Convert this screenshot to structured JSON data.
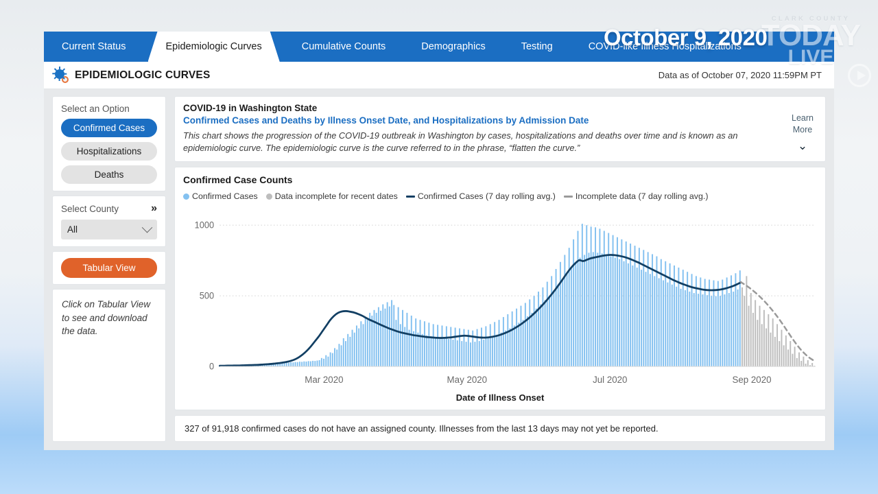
{
  "overlay": {
    "date_text": "October 9, 2020",
    "watermark": {
      "line1": "CLARK COUNTY",
      "line2": "TODAY",
      "line3": "LIVE",
      "play_icon": "play-circle-icon"
    }
  },
  "tabs": [
    {
      "label": "Current Status",
      "active": false
    },
    {
      "label": "Epidemiologic Curves",
      "active": true
    },
    {
      "label": "Cumulative Counts",
      "active": false
    },
    {
      "label": "Demographics",
      "active": false
    },
    {
      "label": "Testing",
      "active": false
    },
    {
      "label": "COVID-like Illness Hospitalizations",
      "active": false
    }
  ],
  "header": {
    "logo_icon": "virus-icon",
    "title": "EPIDEMIOLOGIC CURVES",
    "data_asof": "Data as of October 07, 2020 11:59PM PT"
  },
  "sidebar": {
    "option_label": "Select an Option",
    "options": [
      {
        "label": "Confirmed Cases",
        "selected": true
      },
      {
        "label": "Hospitalizations",
        "selected": false
      },
      {
        "label": "Deaths",
        "selected": false
      }
    ],
    "county_label": "Select County",
    "county_expand_icon": "chevron-double-right-icon",
    "county_value": "All",
    "county_dropdown_icon": "chevron-down-icon",
    "tabular_view_label": "Tabular View",
    "hint": "Click on Tabular View to see and download the data."
  },
  "intro": {
    "title": "COVID-19 in Washington State",
    "subtitle": "Confirmed Cases and Deaths by Illness Onset Date, and Hospitalizations by Admission Date",
    "description": "This chart shows the progression of the COVID-19 outbreak in Washington by cases, hospitalizations and deaths over time and is known as an epidemiologic curve. The epidemiologic curve is the curve referred to in the phrase, “flatten the curve.”",
    "learn_more_line1": "Learn",
    "learn_more_line2": "More",
    "learn_more_icon": "chevron-double-down-icon"
  },
  "footer": {
    "note": "327 of 91,918 confirmed cases do not have an assigned county. Illnesses from the last 13 days may not yet be reported."
  },
  "colors": {
    "brand_blue": "#1b6ec2",
    "bar_blue": "#84c1f0",
    "bar_gray": "#bdbdbd",
    "line_navy": "#123f63",
    "line_gray": "#9a9a9a",
    "accent_orange": "#e0622a"
  },
  "chart_data": {
    "type": "bar",
    "title": "Confirmed Case Counts",
    "xlabel": "Date of Illness Onset",
    "ylabel": "",
    "ylim": [
      0,
      1100
    ],
    "yticks": [
      0,
      500,
      1000
    ],
    "ytick_labels": [
      "0",
      "500",
      "1000"
    ],
    "xtick_labels": [
      "Mar 2020",
      "May 2020",
      "Jul 2020",
      "Sep 2020"
    ],
    "xtick_positions": [
      0.175,
      0.415,
      0.655,
      0.893
    ],
    "grid": true,
    "legend_position": "top",
    "legend": [
      {
        "label": "Confirmed Cases",
        "marker": "dot",
        "color": "#84c1f0"
      },
      {
        "label": "Data incomplete for recent dates",
        "marker": "dot",
        "color": "#bdbdbd"
      },
      {
        "label": "Confirmed Cases (7 day rolling avg.)",
        "marker": "line",
        "color": "#123f63"
      },
      {
        "label": "Incomplete data (7 day rolling avg.)",
        "marker": "line",
        "color": "#9a9a9a"
      }
    ],
    "series": [
      {
        "name": "Confirmed Cases",
        "type": "bar",
        "color": "#84c1f0",
        "values": [
          2,
          1,
          3,
          2,
          4,
          3,
          5,
          4,
          6,
          5,
          8,
          7,
          10,
          9,
          12,
          11,
          14,
          13,
          16,
          15,
          18,
          17,
          20,
          19,
          22,
          21,
          24,
          23,
          26,
          25,
          28,
          27,
          30,
          29,
          32,
          31,
          34,
          33,
          36,
          35,
          38,
          37,
          40,
          39,
          42,
          45,
          60,
          55,
          80,
          70,
          100,
          95,
          130,
          120,
          160,
          150,
          200,
          180,
          230,
          210,
          260,
          240,
          290,
          270,
          320,
          300,
          350,
          330,
          380,
          360,
          400,
          380,
          420,
          395,
          440,
          410,
          455,
          425,
          470,
          435,
          330,
          420,
          300,
          400,
          280,
          380,
          260,
          360,
          250,
          340,
          240,
          330,
          230,
          320,
          220,
          310,
          215,
          300,
          210,
          295,
          205,
          290,
          200,
          285,
          195,
          280,
          190,
          275,
          185,
          270,
          180,
          265,
          175,
          260,
          170,
          255,
          175,
          265,
          180,
          275,
          190,
          285,
          200,
          300,
          210,
          315,
          225,
          330,
          240,
          350,
          255,
          370,
          270,
          390,
          290,
          410,
          310,
          430,
          330,
          450,
          355,
          475,
          380,
          500,
          410,
          530,
          440,
          560,
          470,
          600,
          500,
          640,
          540,
          690,
          580,
          740,
          620,
          790,
          660,
          840,
          700,
          900,
          740,
          960,
          770,
          1010,
          790,
          1000,
          805,
          990,
          810,
          985,
          805,
          975,
          800,
          960,
          790,
          945,
          780,
          930,
          770,
          915,
          760,
          900,
          745,
          885,
          730,
          870,
          715,
          855,
          700,
          840,
          685,
          825,
          670,
          810,
          655,
          795,
          640,
          780,
          625,
          760,
          610,
          745,
          595,
          730,
          580,
          715,
          565,
          700,
          550,
          685,
          540,
          670,
          530,
          655,
          520,
          640,
          515,
          630,
          510,
          620,
          505,
          615,
          500,
          610,
          498,
          605,
          500,
          615,
          510,
          630,
          520,
          645,
          530,
          660,
          545,
          680
        ],
        "note": "Daily confirmed cases by illness onset, Feb-Sep 2020"
      },
      {
        "name": "Data incomplete for recent dates",
        "type": "bar",
        "color": "#bdbdbd",
        "values": [
          560,
          500,
          640,
          430,
          520,
          380,
          470,
          330,
          430,
          300,
          400,
          270,
          370,
          240,
          340,
          210,
          300,
          180,
          260,
          150,
          220,
          120,
          180,
          90,
          140,
          60,
          100,
          40,
          70,
          20,
          45,
          10,
          25,
          5
        ],
        "note": "Last ~13 days, gray incomplete bars"
      }
    ],
    "rolling_avg": {
      "name": "Confirmed Cases (7 day rolling avg.)",
      "color": "#123f63",
      "values": [
        5,
        5,
        6,
        6,
        7,
        7,
        8,
        9,
        10,
        11,
        12,
        14,
        16,
        18,
        21,
        24,
        28,
        33,
        40,
        50,
        65,
        85,
        110,
        140,
        175,
        210,
        250,
        290,
        330,
        360,
        380,
        390,
        392,
        388,
        382,
        372,
        360,
        345,
        330,
        318,
        305,
        292,
        280,
        268,
        258,
        248,
        240,
        234,
        228,
        222,
        218,
        214,
        210,
        207,
        205,
        203,
        202,
        203,
        205,
        208,
        212,
        216,
        218,
        216,
        212,
        208,
        205,
        204,
        206,
        210,
        216,
        224,
        234,
        246,
        260,
        276,
        294,
        314,
        336,
        360,
        386,
        414,
        444,
        476,
        510,
        546,
        584,
        624,
        664,
        700,
        730,
        752,
        746,
        756,
        766,
        772,
        778,
        784,
        788,
        790,
        788,
        784,
        778,
        770,
        760,
        748,
        736,
        722,
        708,
        694,
        680,
        666,
        652,
        638,
        624,
        610,
        598,
        586,
        576,
        566,
        558,
        552,
        546,
        542,
        540,
        540,
        542,
        546,
        552,
        560,
        570,
        582,
        596
      ],
      "note": "7-day rolling average, navy solid line"
    },
    "rolling_avg_incomplete": {
      "name": "Incomplete data (7 day rolling avg.)",
      "color": "#9a9a9a",
      "style": "dashed",
      "values": [
        596,
        570,
        540,
        505,
        465,
        420,
        370,
        315,
        255,
        195,
        140,
        95,
        60,
        35
      ],
      "note": "Gray dashed continuation for incomplete recent dates"
    }
  }
}
